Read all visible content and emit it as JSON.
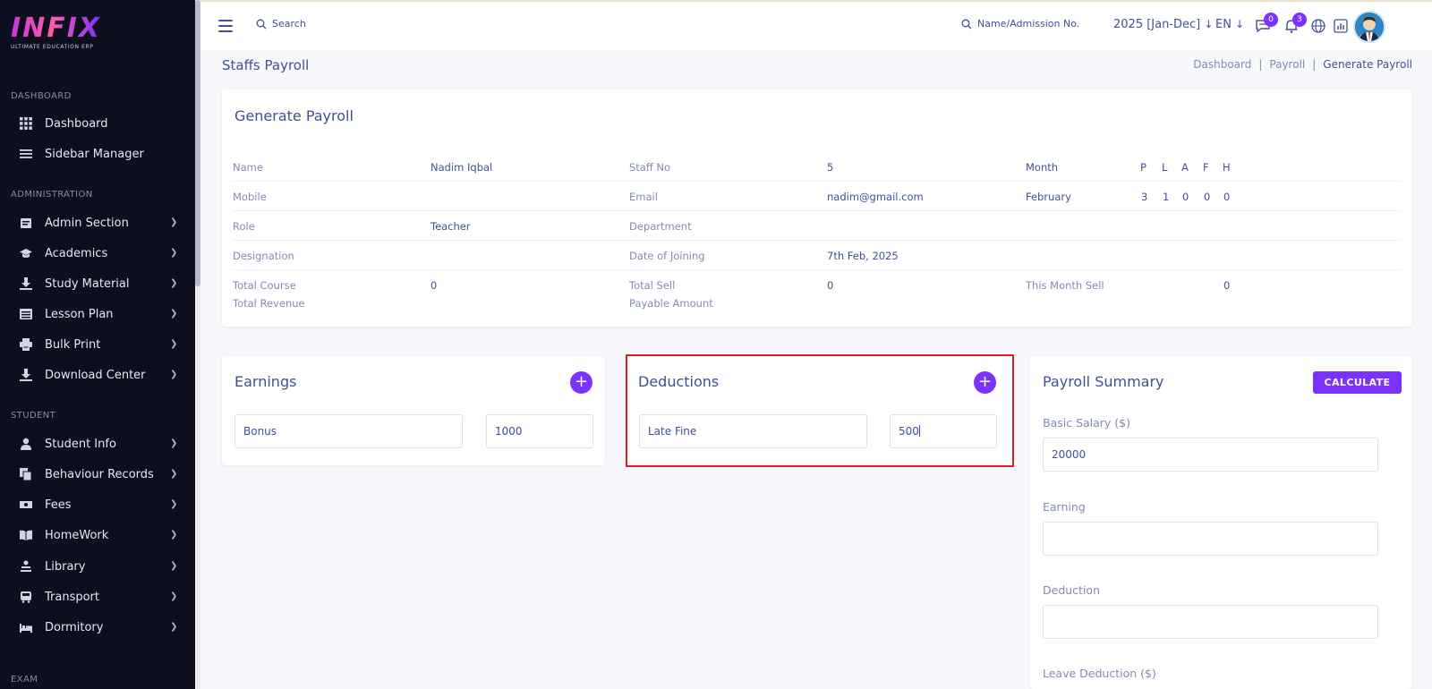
{
  "brand": {
    "logo_text": "INFIX",
    "logo_sub": "ULTIMATE EDUCATION ERP"
  },
  "sidebar": {
    "sections": [
      {
        "label": "DASHBOARD"
      },
      {
        "label": "ADMINISTRATION"
      },
      {
        "label": "STUDENT"
      },
      {
        "label": "EXAM"
      }
    ],
    "items": [
      {
        "label": "Dashboard",
        "icon": "grid-icon"
      },
      {
        "label": "Sidebar Manager",
        "icon": "list-icon"
      },
      {
        "label": "Admin Section",
        "icon": "admin-icon"
      },
      {
        "label": "Academics",
        "icon": "graduation-cap-icon"
      },
      {
        "label": "Study Material",
        "icon": "download-icon"
      },
      {
        "label": "Lesson Plan",
        "icon": "list-alt-icon"
      },
      {
        "label": "Bulk Print",
        "icon": "printer-icon"
      },
      {
        "label": "Download Center",
        "icon": "download-icon"
      },
      {
        "label": "Student Info",
        "icon": "user-icon"
      },
      {
        "label": "Behaviour Records",
        "icon": "copy-icon"
      },
      {
        "label": "Fees",
        "icon": "money-icon"
      },
      {
        "label": "HomeWork",
        "icon": "book-icon"
      },
      {
        "label": "Library",
        "icon": "library-icon"
      },
      {
        "label": "Transport",
        "icon": "bus-icon"
      },
      {
        "label": "Dormitory",
        "icon": "bed-icon"
      }
    ]
  },
  "topbar": {
    "search_label": "Search",
    "student_search_label": "Name/Admission No.",
    "session": "2025 [Jan-Dec]",
    "language": "EN",
    "messages_count": "0",
    "notifications_count": "3"
  },
  "page": {
    "title": "Staffs Payroll",
    "breadcrumb": [
      "Dashboard",
      "Payroll",
      "Generate Payroll"
    ]
  },
  "generate": {
    "title": "Generate Payroll",
    "name_label": "Name",
    "name": "Nadim Iqbal",
    "staff_no_label": "Staff No",
    "staff_no": "5",
    "month_label": "Month",
    "month": "February",
    "attendance_headers": [
      "P",
      "L",
      "A",
      "F",
      "H"
    ],
    "attendance_values": [
      "3",
      "1",
      "0",
      "0",
      "0"
    ],
    "mobile_label": "Mobile",
    "email_label": "Email",
    "email": "nadim@gmail.com",
    "role_label": "Role",
    "role": "Teacher",
    "department_label": "Department",
    "designation_label": "Designation",
    "doj_label": "Date of Joining",
    "doj": "7th Feb, 2025",
    "total_course_label": "Total Course",
    "total_course": "0",
    "total_revenue_label": "Total Revenue",
    "total_sell_label": "Total Sell",
    "total_sell": "0",
    "payable_label": "Payable Amount",
    "month_sell_label": "This Month Sell",
    "month_sell": "0"
  },
  "earnings": {
    "title": "Earnings",
    "type": "Bonus",
    "amount": "1000"
  },
  "deductions": {
    "title": "Deductions",
    "type": "Late Fine",
    "amount": "500"
  },
  "summary": {
    "title": "Payroll Summary",
    "calculate_label": "CALCULATE",
    "basic_label": "Basic Salary ($)",
    "basic": "20000",
    "earning_label": "Earning",
    "earning": "",
    "deduction_label": "Deduction",
    "deduction": "",
    "leave_label": "Leave Deduction ($)"
  },
  "colors": {
    "accent": "#7c32ff",
    "text": "#415094",
    "sidebar": "#0d0f1f",
    "highlight": "#e8191f"
  }
}
